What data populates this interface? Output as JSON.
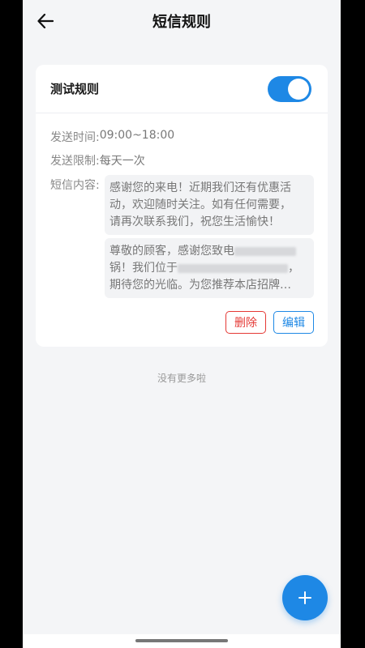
{
  "header": {
    "title": "短信规则",
    "back_icon": "arrow-left-icon"
  },
  "rule": {
    "name": "测试规则",
    "enabled": true,
    "send_time_label": "发送时间:",
    "send_time_value": "09:00~18:00",
    "limit_label": "发送限制:",
    "limit_value": "每天一次",
    "content_label": "短信内容:",
    "message1_line1": "感谢您的来电！近期我们还有优惠活",
    "message1_line2": "动，欢迎随时关注。如有任何需要，",
    "message1_line3": "请再次联系我们，祝您生活愉快！",
    "message2_line1_a": "尊敬的顾客，感谢您致电",
    "message2_line2_a": "锅！我们位于",
    "message2_line2_b": "，",
    "message2_line3": "期待您的光临。为您推荐本店招牌…",
    "delete_label": "删除",
    "edit_label": "编辑"
  },
  "footer": {
    "no_more": "没有更多啦"
  },
  "fab": {
    "icon": "plus-icon"
  },
  "colors": {
    "accent": "#1e88e5",
    "danger": "#e53935",
    "background": "#f4f5f7"
  }
}
